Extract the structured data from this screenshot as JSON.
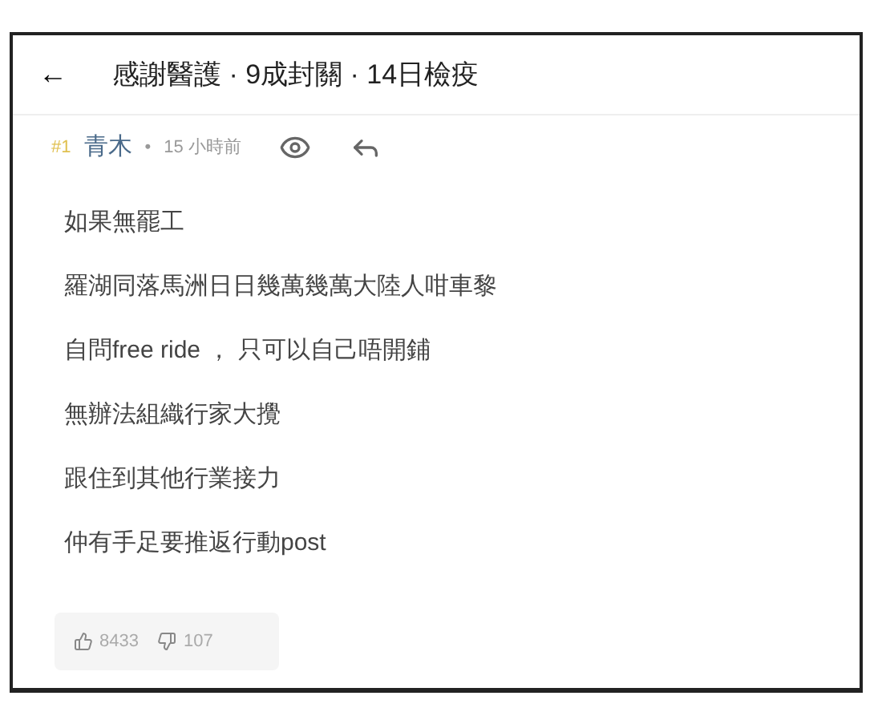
{
  "header": {
    "back": "←",
    "title": "感謝醫護 · 9成封關 · 14日檢疫"
  },
  "post": {
    "floor": "#1",
    "author": "青木",
    "separator": "•",
    "time": "15 小時前",
    "lines": [
      "如果無罷工",
      "羅湖同落馬洲日日幾萬幾萬大陸人咁車黎",
      "自問free ride ， 只可以自己唔開鋪",
      "無辦法組織行家大攪",
      "跟住到其他行業接力",
      "仲有手足要推返行動post"
    ],
    "likes": "8433",
    "dislikes": "107"
  }
}
